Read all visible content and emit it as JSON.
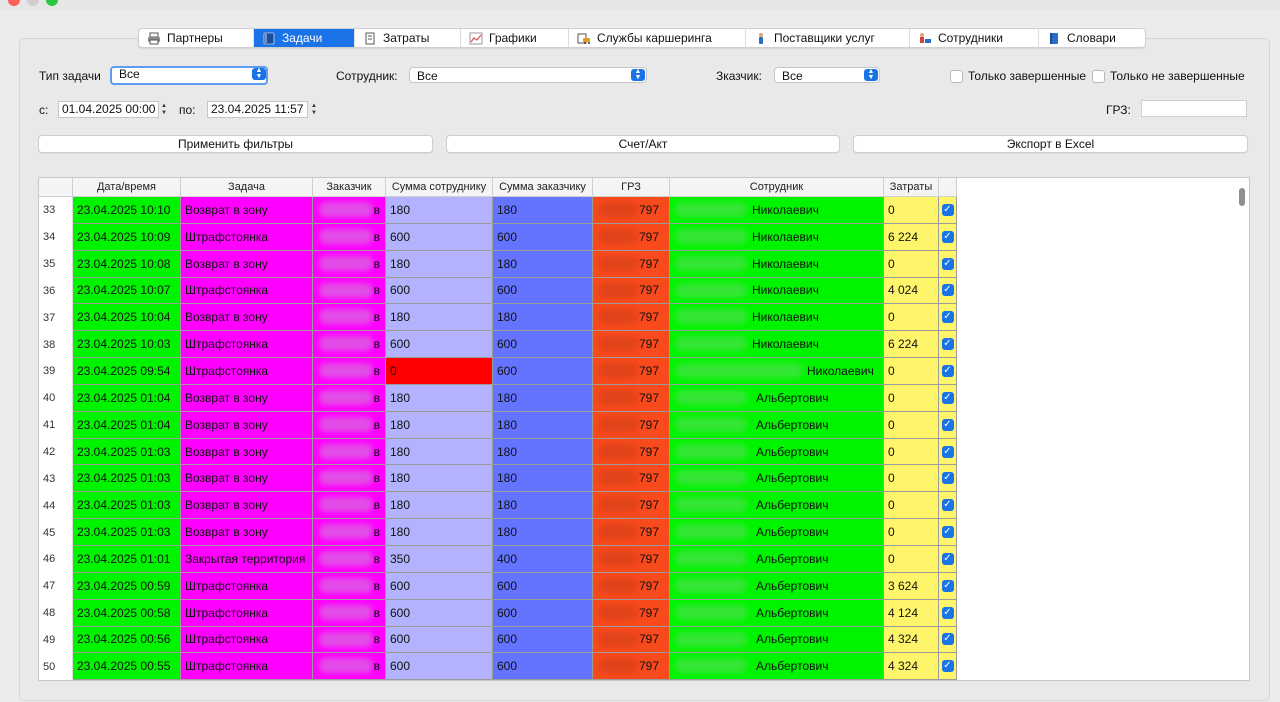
{
  "tabs": [
    {
      "label": "Партнеры",
      "icon": "printer-icon",
      "active": false,
      "w": 115
    },
    {
      "label": "Задачи",
      "icon": "notebook-icon",
      "active": true,
      "w": 101
    },
    {
      "label": "Затраты",
      "icon": "receipt-icon",
      "active": false,
      "w": 106
    },
    {
      "label": "Графики",
      "icon": "chart-icon",
      "active": false,
      "w": 108
    },
    {
      "label": "Службы каршеринга",
      "icon": "cars-icon",
      "active": false,
      "w": 177
    },
    {
      "label": "Поставщики услуг",
      "icon": "person-icon",
      "active": false,
      "w": 164
    },
    {
      "label": "Сотрудники",
      "icon": "workers-icon",
      "active": false,
      "w": 129
    },
    {
      "label": "Словари",
      "icon": "book-icon",
      "active": false,
      "w": 106
    }
  ],
  "filters": {
    "task_type_label": "Тип задачи",
    "task_type_value": "Все",
    "employee_label": "Сотрудник:",
    "employee_value": "Все",
    "customer_label": "Зказчик:",
    "customer_value": "Все",
    "only_completed": "Только завершенные",
    "only_not_completed": "Только не завершенные",
    "from_label": "с:",
    "from_value": "01.04.2025 00:00",
    "to_label": "по:",
    "to_value": "23.04.2025 11:57",
    "grz_label": "ГРЗ:"
  },
  "buttons": {
    "apply": "Применить фильтры",
    "invoice": "Счет/Акт",
    "export": "Экспорт в Excel"
  },
  "columns": [
    "Дата/время",
    "Задача",
    "Заказчик",
    "Сумма сотруднику",
    "Сумма заказчику",
    "ГРЗ",
    "Сотрудник",
    "Затраты"
  ],
  "rows": [
    {
      "n": "33",
      "date": "23.04.2025 10:10",
      "task": "Возврат в зону",
      "cust": "в",
      "sume": "180",
      "sumc": "180",
      "grz": "797",
      "emp": "Николаевич",
      "cost": "0"
    },
    {
      "n": "34",
      "date": "23.04.2025 10:09",
      "task": "Штрафстоянка",
      "cust": "в",
      "sume": "600",
      "sumc": "600",
      "grz": "797",
      "emp": "Николаевич",
      "cost": "6 224"
    },
    {
      "n": "35",
      "date": "23.04.2025 10:08",
      "task": "Возврат в зону",
      "cust": "в",
      "sume": "180",
      "sumc": "180",
      "grz": "797",
      "emp": "Николаевич",
      "cost": "0"
    },
    {
      "n": "36",
      "date": "23.04.2025 10:07",
      "task": "Штрафстоянка",
      "cust": "в",
      "sume": "600",
      "sumc": "600",
      "grz": "797",
      "emp": "Николаевич",
      "cost": "4 024"
    },
    {
      "n": "37",
      "date": "23.04.2025 10:04",
      "task": "Возврат в зону",
      "cust": "в",
      "sume": "180",
      "sumc": "180",
      "grz": "797",
      "emp": "Николаевич",
      "cost": "0"
    },
    {
      "n": "38",
      "date": "23.04.2025 10:03",
      "task": "Штрафстоянка",
      "cust": "в",
      "sume": "600",
      "sumc": "600",
      "grz": "797",
      "emp": "Николаевич",
      "cost": "6 224"
    },
    {
      "n": "39",
      "date": "23.04.2025 09:54",
      "task": "Штрафстоянка",
      "cust": "в",
      "sume": "0",
      "sumc": "600",
      "grz": "797",
      "emp": "Николаевич",
      "cost": "0",
      "sume_red": true,
      "emp_right": true
    },
    {
      "n": "40",
      "date": "23.04.2025 01:04",
      "task": "Возврат в зону",
      "cust": "в",
      "sume": "180",
      "sumc": "180",
      "grz": "797",
      "emp": "Альбертович",
      "cost": "0"
    },
    {
      "n": "41",
      "date": "23.04.2025 01:04",
      "task": "Возврат в зону",
      "cust": "в",
      "sume": "180",
      "sumc": "180",
      "grz": "797",
      "emp": "Альбертович",
      "cost": "0"
    },
    {
      "n": "42",
      "date": "23.04.2025 01:03",
      "task": "Возврат в зону",
      "cust": "в",
      "sume": "180",
      "sumc": "180",
      "grz": "797",
      "emp": "Альбертович",
      "cost": "0"
    },
    {
      "n": "43",
      "date": "23.04.2025 01:03",
      "task": "Возврат в зону",
      "cust": "в",
      "sume": "180",
      "sumc": "180",
      "grz": "797",
      "emp": "Альбертович",
      "cost": "0"
    },
    {
      "n": "44",
      "date": "23.04.2025 01:03",
      "task": "Возврат в зону",
      "cust": "в",
      "sume": "180",
      "sumc": "180",
      "grz": "797",
      "emp": "Альбертович",
      "cost": "0"
    },
    {
      "n": "45",
      "date": "23.04.2025 01:03",
      "task": "Возврат в зону",
      "cust": "в",
      "sume": "180",
      "sumc": "180",
      "grz": "797",
      "emp": "Альбертович",
      "cost": "0"
    },
    {
      "n": "46",
      "date": "23.04.2025 01:01",
      "task": "Закрытая территория",
      "cust": "в",
      "sume": "350",
      "sumc": "400",
      "grz": "797",
      "emp": "Альбертович",
      "cost": "0"
    },
    {
      "n": "47",
      "date": "23.04.2025 00:59",
      "task": "Штрафстоянка",
      "cust": "в",
      "sume": "600",
      "sumc": "600",
      "grz": "797",
      "emp": "Альбертович",
      "cost": "3 624"
    },
    {
      "n": "48",
      "date": "23.04.2025 00:58",
      "task": "Штрафстоянка",
      "cust": "в",
      "sume": "600",
      "sumc": "600",
      "grz": "797",
      "emp": "Альбертович",
      "cost": "4 124"
    },
    {
      "n": "49",
      "date": "23.04.2025 00:56",
      "task": "Штрафстоянка",
      "cust": "в",
      "sume": "600",
      "sumc": "600",
      "grz": "797",
      "emp": "Альбертович",
      "cost": "4 324"
    },
    {
      "n": "50",
      "date": "23.04.2025 00:55",
      "task": "Штрафстоянка",
      "cust": "в",
      "sume": "600",
      "sumc": "600",
      "grz": "797",
      "emp": "Альбертович",
      "cost": "4 324"
    }
  ],
  "colors": {
    "accent": "#1a74e8",
    "date_cell": "#00f400",
    "task_cell": "#ff00ff",
    "sum_employee_cell": "#b2b2ff",
    "sum_customer_cell": "#6474ff",
    "grz_cell": "#f84a1c",
    "cost_cell": "#fff56a",
    "alert_cell": "#ff0000"
  }
}
